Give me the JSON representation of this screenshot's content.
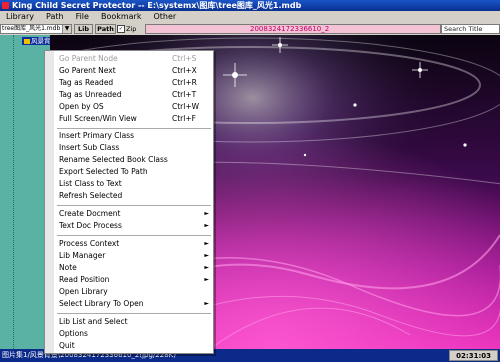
{
  "window": {
    "title": "King Child Secret Protector -- E:\\systemx\\图库\\tree图库_风光1.mdb"
  },
  "menubar": {
    "items": [
      "Library",
      "Path",
      "File",
      "Bookmark",
      "Other"
    ]
  },
  "toolbar": {
    "library_value": "tree图库_风光1.mdb",
    "lib_button": "Lib",
    "path_button": "Path",
    "zip_label": "Zip",
    "zip_checked": true,
    "path_value": "2008324172336610_2",
    "search_placeholder": "Search Title"
  },
  "tree": {
    "selected_node": "风景背景"
  },
  "statusbar": {
    "info": "图片集1/风景背景\\2008324172336610_2(jpg/228K)",
    "time": "02:31:03"
  },
  "context_menu": {
    "items": [
      {
        "label": "Go Parent Node",
        "shortcut": "Ctrl+S",
        "disabled": true
      },
      {
        "label": "Go Parent Next",
        "shortcut": "Ctrl+X"
      },
      {
        "label": "Tag as Readed",
        "shortcut": "Ctrl+R"
      },
      {
        "label": "Tag as Unreaded",
        "shortcut": "Ctrl+T"
      },
      {
        "label": "Open by OS",
        "shortcut": "Ctrl+W"
      },
      {
        "label": "Full Screen/Win View",
        "shortcut": "Ctrl+F"
      },
      {
        "label": "Insert Primary Class"
      },
      {
        "label": "Insert Sub Class"
      },
      {
        "label": "Rename Selected Book Class"
      },
      {
        "label": "Export Selected To Path"
      },
      {
        "label": "List Class to Text"
      },
      {
        "label": "Refresh Selected"
      },
      {
        "label": "Create Docment",
        "submenu": true
      },
      {
        "label": "Text Doc Process",
        "submenu": true
      },
      {
        "label": "Process Context",
        "submenu": true
      },
      {
        "label": "Lib Manager",
        "submenu": true
      },
      {
        "label": "Note",
        "submenu": true
      },
      {
        "label": "Read Position",
        "submenu": true
      },
      {
        "label": "Open Library"
      },
      {
        "label": "Select Library To Open",
        "submenu": true
      },
      {
        "label": "Lib List and Select"
      },
      {
        "label": "Options"
      },
      {
        "label": "Quit"
      }
    ]
  },
  "colors": {
    "title_bar": "#0a2f8f",
    "tree_bg": "#5ab2a4",
    "image_magenta": "#d21aa8",
    "status_bar": "#0b2a8a"
  }
}
